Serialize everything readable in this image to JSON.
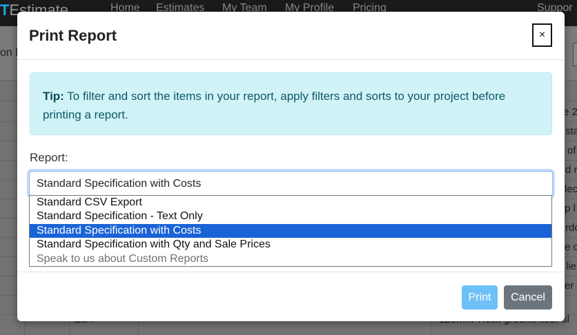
{
  "background": {
    "brand_lead": "T",
    "brand_rest": "Estimate",
    "nav": [
      "Home",
      "Estimates",
      "My Team",
      "My Profile",
      "Pricing",
      "Suppor"
    ],
    "sub_text": "on R",
    "cells": [
      "e 2",
      "sta",
      "of",
      "d r",
      "lec",
      "p l",
      "rdo",
      "e c",
      "lie",
      "er",
      "EST",
      "125mm Thick ground floor sl"
    ]
  },
  "modal": {
    "title": "Print Report",
    "close_label": "×",
    "tip_label": "Tip:",
    "tip_text": " To filter and sort the items in your report, apply filters and sorts to your project before printing a report.",
    "report_label": "Report:",
    "selected_value": "Standard Specification with Costs",
    "options": [
      {
        "label": "Standard CSV Export",
        "state": "normal"
      },
      {
        "label": "Standard Specification - Text Only",
        "state": "normal"
      },
      {
        "label": "Standard Specification with Costs",
        "state": "selected"
      },
      {
        "label": "Standard Specification with Qty and Sale Prices",
        "state": "normal"
      },
      {
        "label": "Speak to us about Custom Reports",
        "state": "disabled"
      }
    ],
    "print_label": "Print",
    "cancel_label": "Cancel"
  },
  "colors": {
    "accent": "#1a63d6",
    "tip_bg": "#d1f3f8",
    "print_btn": "#6ec1f7",
    "cancel_btn": "#6c757d"
  }
}
